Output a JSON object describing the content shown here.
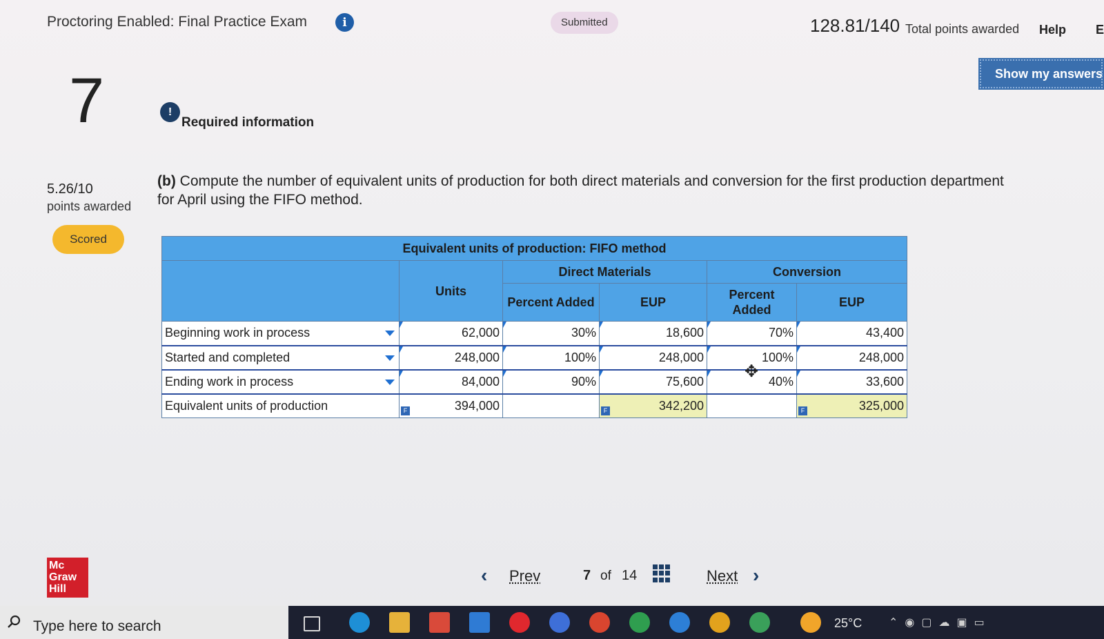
{
  "header": {
    "title": "Proctoring Enabled: Final Practice Exam",
    "status": "Submitted",
    "score_total": "128.81/140",
    "score_total_label": "Total points awarded",
    "help": "Help",
    "cut_letter": "E",
    "show_answers": "Show my answers"
  },
  "question": {
    "number": "7",
    "points": "5.26/10",
    "points_label": "points awarded",
    "badge": "Scored",
    "required_info": "Required information",
    "part": "(b)",
    "text_line1": "Compute the number of equivalent units of production for both direct materials and conversion for the first production department",
    "text_line2": "for April using the FIFO method."
  },
  "table": {
    "title": "Equivalent units of production: FIFO method",
    "groups": {
      "direct_materials": "Direct Materials",
      "conversion": "Conversion"
    },
    "headers": {
      "units": "Units",
      "percent_added": "Percent Added",
      "eup": "EUP"
    },
    "rows": [
      {
        "label": "Beginning work in process",
        "units": "62,000",
        "dm_pct": "30%",
        "dm_eup": "18,600",
        "cv_pct": "70%",
        "cv_eup": "43,400"
      },
      {
        "label": "Started and completed",
        "units": "248,000",
        "dm_pct": "100%",
        "dm_eup": "248,000",
        "cv_pct": "100%",
        "cv_eup": "248,000"
      },
      {
        "label": "Ending work in process",
        "units": "84,000",
        "dm_pct": "90%",
        "dm_eup": "75,600",
        "cv_pct": "40%",
        "cv_eup": "33,600"
      }
    ],
    "total": {
      "label": "Equivalent units of production",
      "units": "394,000",
      "dm_eup": "342,200",
      "cv_eup": "325,000"
    },
    "flag_letter": "F"
  },
  "pager": {
    "prev": "Prev",
    "current": "7",
    "of": "of",
    "total": "14",
    "next": "Next"
  },
  "brand": {
    "line1": "Mc",
    "line2": "Graw",
    "line3": "Hill"
  },
  "taskbar": {
    "search_placeholder": "Type here to search",
    "temperature": "25°C"
  },
  "colors": {
    "table_header": "#4fa3e6",
    "badge": "#f4b82d",
    "button": "#3a6fae",
    "brand_red": "#d21f2a",
    "total_highlight": "#eef0b6"
  }
}
